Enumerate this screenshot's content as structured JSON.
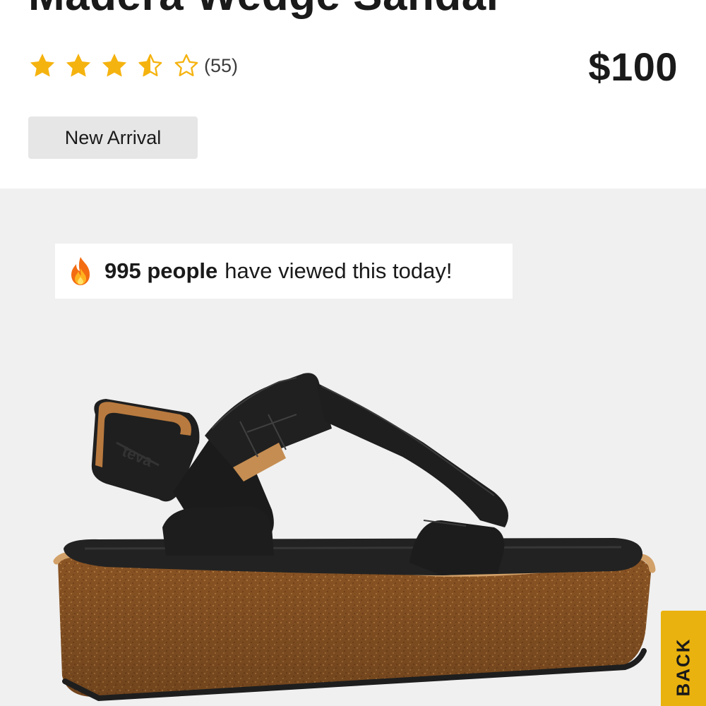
{
  "product": {
    "title": "Madera Wedge Sandal",
    "price": "$100",
    "badge": "New Arrival"
  },
  "rating": {
    "value": 3.5,
    "max": 5,
    "review_count": "(55)",
    "star_color": "#f5b30f",
    "stars": [
      "star-full-icon",
      "star-full-icon",
      "star-full-icon",
      "star-half-icon",
      "star-empty-icon"
    ]
  },
  "viewers_banner": {
    "icon": "fire-icon",
    "count_text": "995 people",
    "message": "have viewed this today!"
  },
  "gallery": {
    "background": "#f0f0f0"
  },
  "feedback_tab": {
    "label": "BACK",
    "color": "#e9b20e"
  }
}
